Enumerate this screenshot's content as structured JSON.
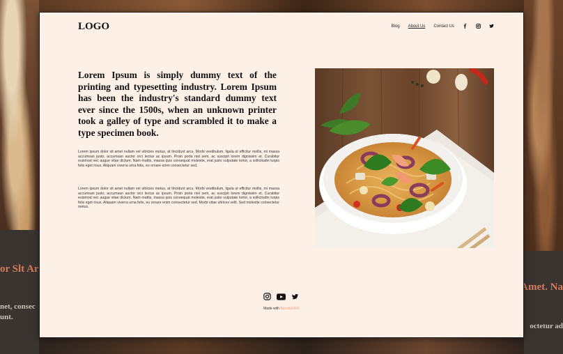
{
  "background": {
    "left_heading": "or Slt Ar",
    "left_line1": "net, consec",
    "left_line2": "unt.",
    "right_heading": "Amet. Na",
    "right_line1": "octetur ad"
  },
  "header": {
    "logo": "LOGO",
    "nav": [
      {
        "label": "Blog",
        "active": false
      },
      {
        "label": "About Us",
        "active": true
      },
      {
        "label": "Contact Us",
        "active": false
      }
    ],
    "social_icons": [
      "facebook-icon",
      "instagram-icon",
      "twitter-icon"
    ]
  },
  "main": {
    "headline": "Lorem Ipsum is simply dummy text of the printing and typesetting industry. Lorem Ipsum has been the industry's standard dummy text ever since the 1500s, when an unknown printer took a galley of type and scrambled it to make a type specimen book.",
    "paragraph1": "Lorem ipsum dolor sit amet nullam vel ultricies metus, at tincidunt arcu. Morbi vestibulum, ligula ut efficitur mollis, mi massa accumsan justo, accumsan auctor orci lectus ac ipsum. Proin porta nisl sem, ac suscipit lorem dignissim et. Curabitur euismod nec augue vitae dictum. Nam mattis, massa quis consequat molestie, erat justo vulputate tortor, a sollicitudin turpis felis eget risus. Aliquam viverra urna felis, eu ornare enim consectetur sed.",
    "paragraph2": "Lorem ipsum dolor sit amet nullam vel ultricies metus, at tincidunt arcu. Morbi vestibulum, ligula ut efficitur mollis, mi massa accumsan justo, accumsan auctor orci lectus ac ipsum. Proin porta nisl sem, ac suscipit lorem dignissim et. Curabitur euismod nec augue vitae dictum. Nam mattis, massa quis consequat molestie, erat justo vulputate tortor, a sollicitudin turpis felis eget risus. Aliquam viverra urna felis, eu ornare enim consectetur sed. Morbi vitae ultrices velit. Sed molestie consectetur metus."
  },
  "footer": {
    "social_icons": [
      "instagram-icon",
      "youtube-icon",
      "twitter-icon"
    ],
    "made_with": "Made with",
    "made_with_link": "ByombUIUX"
  },
  "colors": {
    "card_background": "#fdf0e7",
    "accent": "#f19a7a",
    "text": "#111111"
  }
}
